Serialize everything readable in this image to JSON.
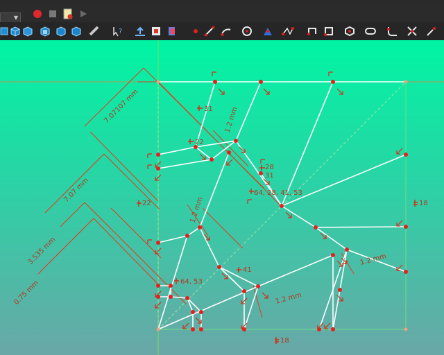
{
  "toolbar": {
    "row1": [
      "record-macro-icon",
      "stop-macro-icon",
      "macros-icon",
      "execute-macro-icon"
    ],
    "row2": [
      "view-fit-icon",
      "view-isometric-icon",
      "view-front-icon",
      "view-top-icon",
      "view-right-icon",
      "measure-icon",
      "whats-this-icon",
      "leave-sketch-icon",
      "view-sketch-icon",
      "view-section-icon",
      "sketch-point-icon",
      "sketch-line-icon",
      "sketch-arc-icon",
      "sketch-circle-icon",
      "sketch-conic-icon",
      "sketch-bspline-icon",
      "sketch-polyline-icon",
      "sketch-rectangle-icon",
      "sketch-polygon-icon",
      "sketch-slot-icon",
      "sketch-fillet-icon",
      "sketch-trim-icon",
      "sketch-extend-icon"
    ]
  },
  "sketch": {
    "dimensions": [
      {
        "id": "dim-7-07107",
        "text": "7.07107 mm"
      },
      {
        "id": "dim-7-07",
        "text": "7.07 mm"
      },
      {
        "id": "dim-3-535",
        "text": "3.535 mm"
      },
      {
        "id": "dim-0-75",
        "text": "0.75 mm"
      },
      {
        "id": "dim-1-2-a",
        "text": "1.2 mm"
      },
      {
        "id": "dim-1-2-b",
        "text": "1.2 mm"
      },
      {
        "id": "dim-1-2-c",
        "text": "1.2 mm"
      },
      {
        "id": "dim-1-2-d",
        "text": "1.2 mm"
      }
    ],
    "constraints": [
      {
        "id": "c31a",
        "text": "31"
      },
      {
        "id": "c22a",
        "text": "22"
      },
      {
        "id": "c28",
        "text": "28"
      },
      {
        "id": "c31b",
        "text": "31"
      },
      {
        "id": "c64a",
        "text": "64, 28, 41, 53"
      },
      {
        "id": "c22b",
        "text": "22"
      },
      {
        "id": "c18a",
        "text": "18"
      },
      {
        "id": "c41",
        "text": "41"
      },
      {
        "id": "c64b",
        "text": "64, 53"
      },
      {
        "id": "c18b",
        "text": "18"
      }
    ]
  }
}
